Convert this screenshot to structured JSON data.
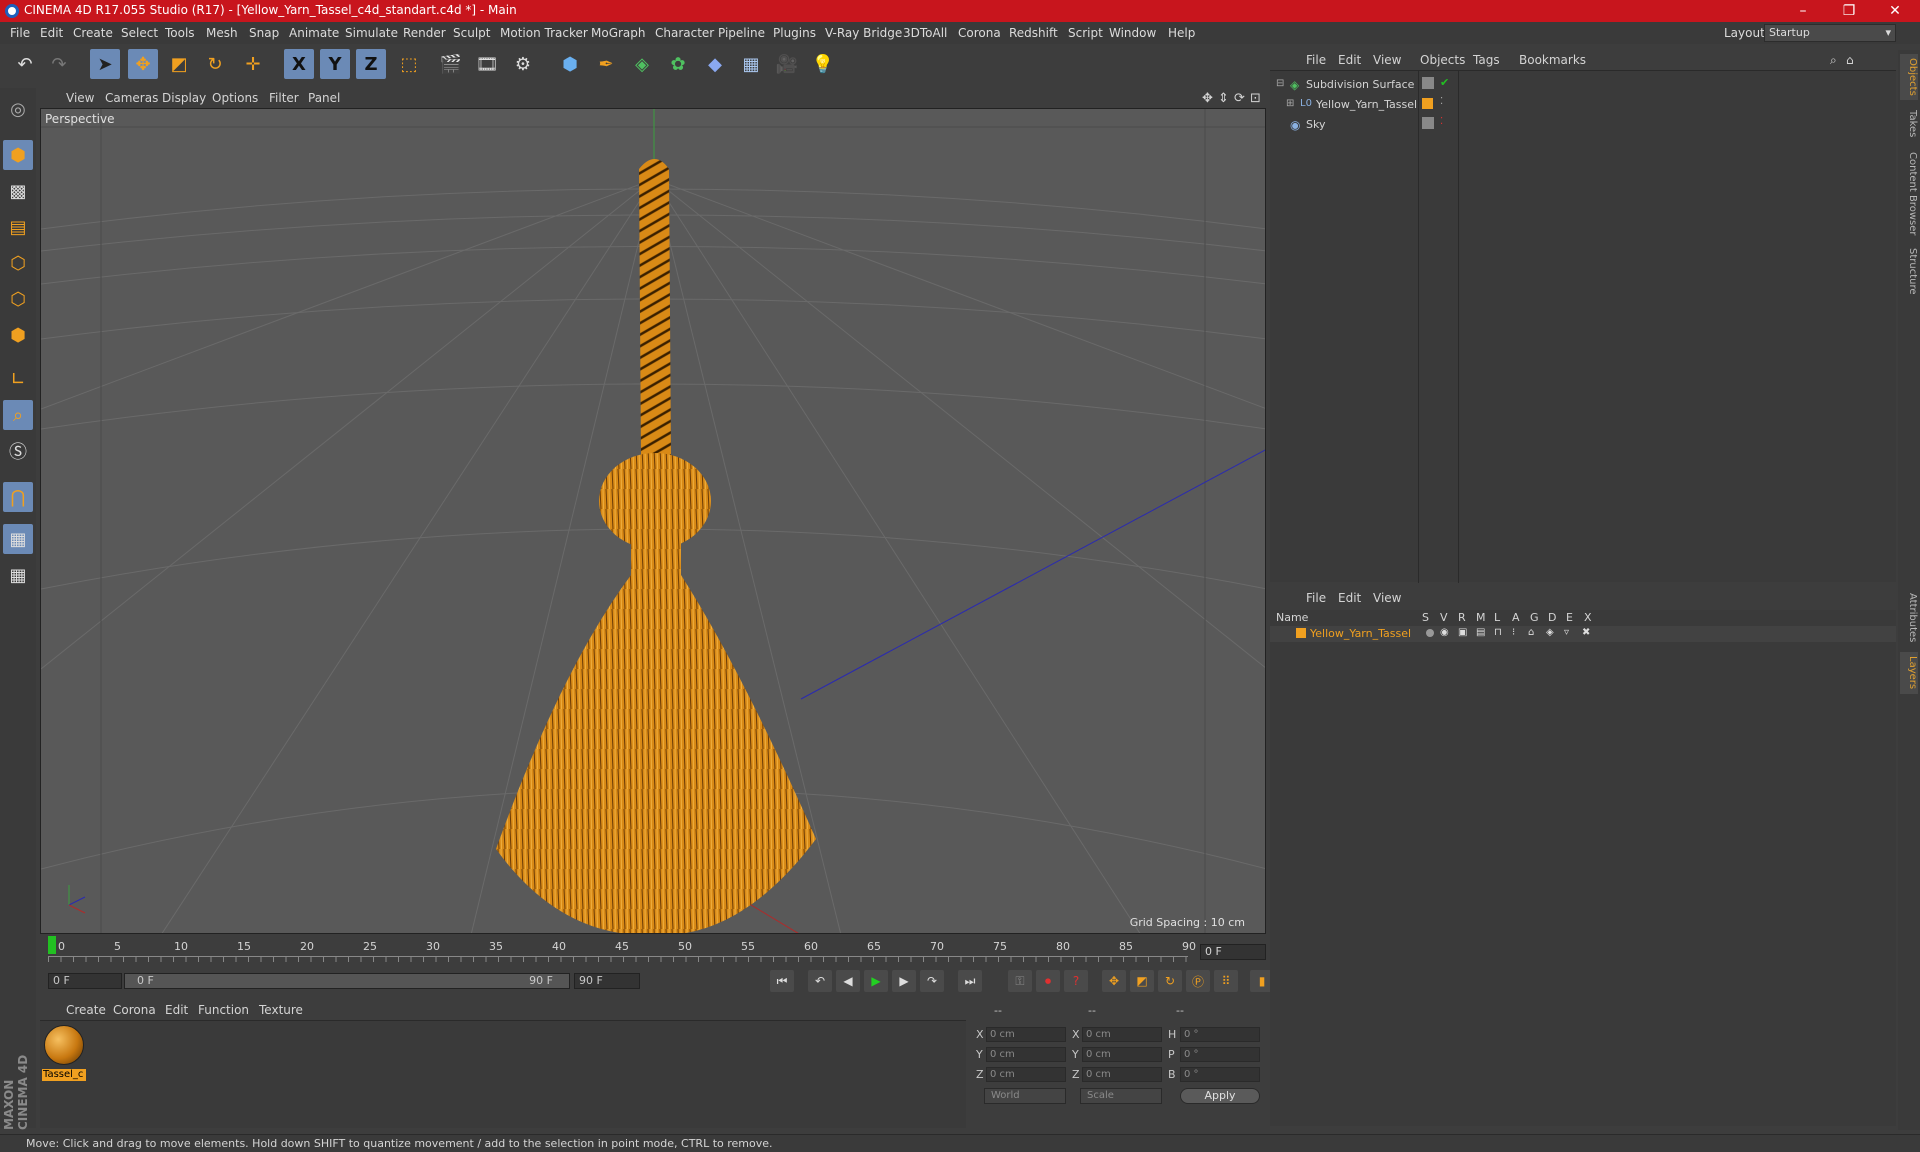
{
  "titlebar": {
    "title": "CINEMA 4D R17.055 Studio (R17) - [Yellow_Yarn_Tassel_c4d_standart.c4d *] - Main",
    "minimize": "–",
    "maximize": "❐",
    "close": "✕"
  },
  "menubar": {
    "items": [
      "File",
      "Edit",
      "Create",
      "Select",
      "Tools",
      "Mesh",
      "Snap",
      "Animate",
      "Simulate",
      "Render",
      "Sculpt",
      "Motion Tracker",
      "MoGraph",
      "Character",
      "Pipeline",
      "Plugins",
      "V-Ray Bridge",
      "3DToAll",
      "Corona",
      "Redshift",
      "Script",
      "Window",
      "Help"
    ],
    "layout_label": "Layout:",
    "layout_value": "Startup"
  },
  "toolbar": {
    "axis_x": "X",
    "axis_y": "Y",
    "axis_z": "Z"
  },
  "viewport": {
    "menu": [
      "View",
      "Cameras",
      "Display",
      "Options",
      "Filter",
      "Panel"
    ],
    "camera_label": "Perspective",
    "grid_spacing": "Grid Spacing : 10 cm",
    "object_color": "#d98a16"
  },
  "timeline": {
    "ticks": [
      "0",
      "5",
      "10",
      "15",
      "20",
      "25",
      "30",
      "35",
      "40",
      "45",
      "50",
      "55",
      "60",
      "65",
      "70",
      "75",
      "80",
      "85",
      "90"
    ],
    "current_frame": "0 F"
  },
  "transport": {
    "start_frame": "0 F",
    "range_start": "0 F",
    "range_end": "90 F",
    "end_frame": "90 F"
  },
  "material_manager": {
    "menu": [
      "Create",
      "Corona",
      "Edit",
      "Function",
      "Texture"
    ],
    "material_name": "Tassel_c"
  },
  "coordinates": {
    "header": [
      "--",
      "--",
      "--"
    ],
    "pos_labels": [
      "X",
      "Y",
      "Z"
    ],
    "pos_values": [
      "0 cm",
      "0 cm",
      "0 cm"
    ],
    "size_labels": [
      "X",
      "Y",
      "Z"
    ],
    "size_values": [
      "0 cm",
      "0 cm",
      "0 cm"
    ],
    "rot_labels": [
      "H",
      "P",
      "B"
    ],
    "rot_values": [
      "0 °",
      "0 °",
      "0 °"
    ],
    "mode_world": "World",
    "mode_scale": "Scale",
    "apply": "Apply"
  },
  "status": {
    "text": "Move: Click and drag to move elements. Hold down SHIFT to quantize movement / add to the selection in point mode, CTRL to remove."
  },
  "object_manager": {
    "menu": [
      "File",
      "Edit",
      "View",
      "Objects",
      "Tags",
      "Bookmarks"
    ],
    "objects": [
      {
        "name": "Subdivision Surface"
      },
      {
        "name": "Yellow_Yarn_Tassel"
      },
      {
        "name": "Sky"
      }
    ]
  },
  "layers_manager": {
    "menu": [
      "File",
      "Edit",
      "View"
    ],
    "columns": [
      "Name",
      "S",
      "V",
      "R",
      "M",
      "L",
      "A",
      "G",
      "D",
      "E",
      "X"
    ],
    "layer_name": "Yellow_Yarn_Tassel",
    "layer_color": "#f0a020"
  },
  "right_tabs": [
    "Objects",
    "Takes",
    "Content Browser",
    "Structure",
    "Attributes",
    "Layers"
  ],
  "brand": "MAXON CINEMA 4D"
}
